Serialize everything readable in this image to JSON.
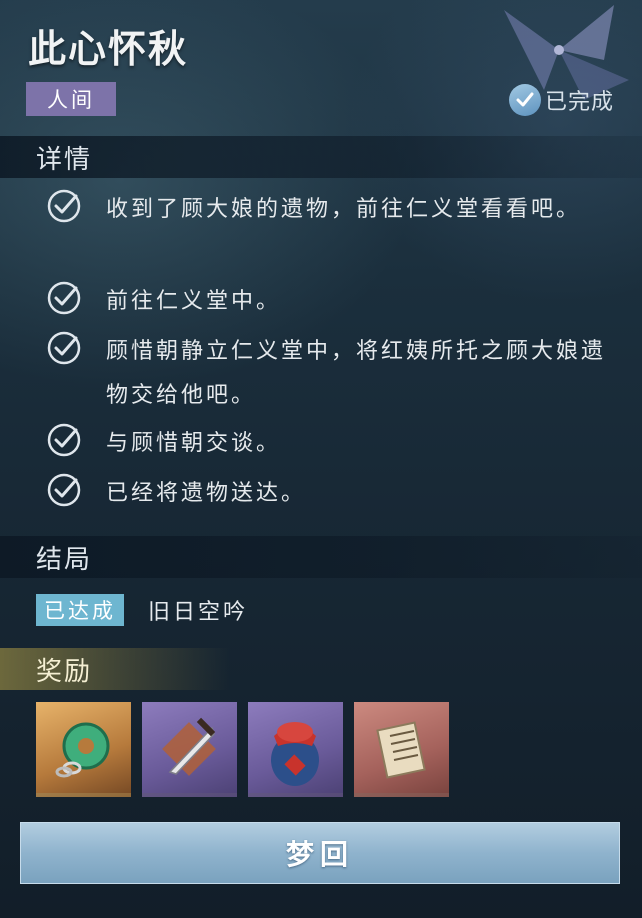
{
  "quest": {
    "title": "此心怀秋",
    "realm": "人间",
    "status": "已完成"
  },
  "sections": {
    "details": "详情",
    "ending": "结局",
    "reward": "奖励"
  },
  "objectives": [
    {
      "text": "收到了顾大娘的遗物，前往仁义堂看看吧。",
      "done": true
    },
    {
      "text": "前往仁义堂中。",
      "done": true
    },
    {
      "text": "顾惜朝静立仁义堂中，将红姨所托之顾大娘遗物交给他吧。",
      "done": true
    },
    {
      "text": "与顾惜朝交谈。",
      "done": true
    },
    {
      "text": "已经将遗物送达。",
      "done": true
    }
  ],
  "ending": {
    "badge": "已达成",
    "name": "旧日空吟"
  },
  "rewards": [
    {
      "icon": "jade-pendant-icon",
      "rarity": "gold"
    },
    {
      "icon": "dagger-icon",
      "rarity": "purple"
    },
    {
      "icon": "wine-jar-icon",
      "rarity": "purple"
    },
    {
      "icon": "scroll-icon",
      "rarity": "red"
    }
  ],
  "button": {
    "label": "梦回"
  },
  "colors": {
    "realm_tag": "#7d73a9",
    "ending_badge": "#6eb6d0",
    "reward_header": "#b4a046",
    "button": "#8fb3cd"
  }
}
